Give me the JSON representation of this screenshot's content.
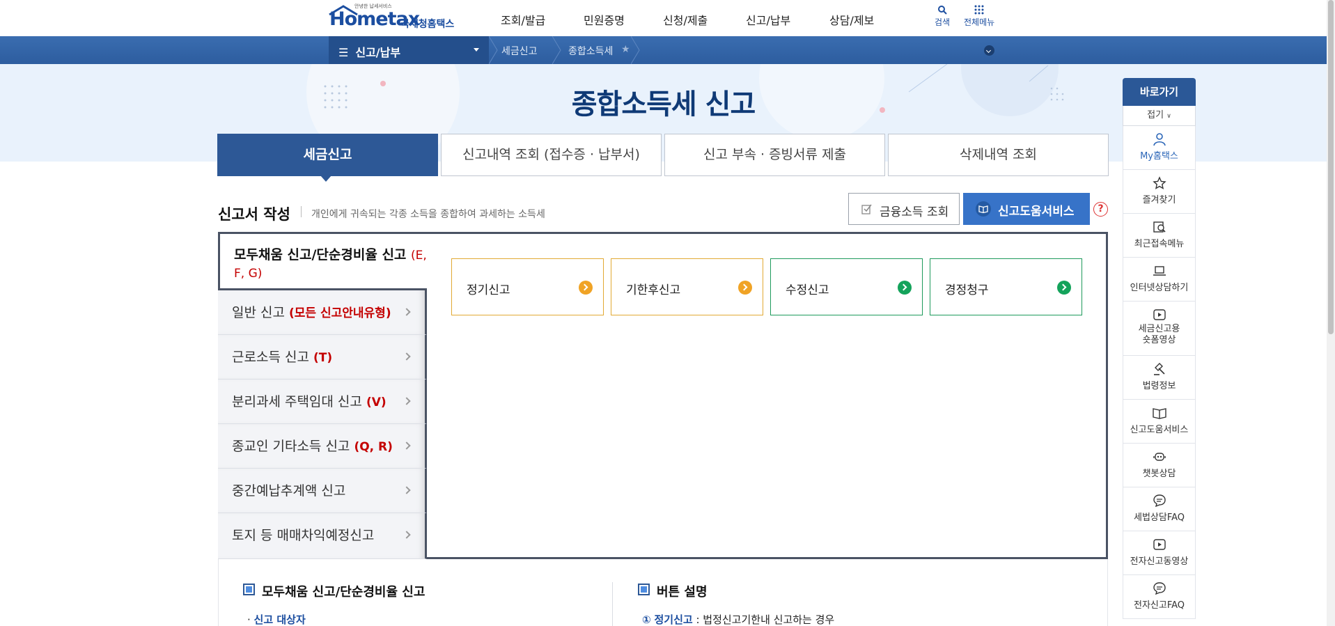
{
  "header": {
    "logo_tagline": "안녕한 납세서비스",
    "logo_main": "Hometax",
    "logo_sub": "국세청홈택스",
    "nav": [
      "조회/발급",
      "민원증명",
      "신청/제출",
      "신고/납부",
      "상담/제보"
    ],
    "search_label": "검색",
    "allmenu_label": "전체메뉴"
  },
  "breadcrumb": {
    "menu": "신고/납부",
    "items": [
      "세금신고",
      "종합소득세"
    ]
  },
  "page_title": "종합소득세 신고",
  "tabs": [
    "세금신고",
    "신고내역 조회 (접수증 · 납부서)",
    "신고 부속 · 증빙서류 제출",
    "삭제내역 조회"
  ],
  "section": {
    "title": "신고서 작성",
    "desc": "개인에게 귀속되는 각종 소득을 종합하여 과세하는 소득세",
    "fin_button": "금융소득 조회",
    "help_button": "신고도움서비스",
    "help_icon": "?"
  },
  "side_menu": {
    "first_label": "모두채움 신고/단순경비율 신고",
    "first_code": "(E, F, G)",
    "items": [
      {
        "label": "일반 신고",
        "code": "(모든 신고안내유형)"
      },
      {
        "label": "근로소득 신고",
        "code": "(T)"
      },
      {
        "label": "분리과세 주택임대 신고",
        "code": "(V)"
      },
      {
        "label": "종교인 기타소득 신고",
        "code": "(Q, R)"
      },
      {
        "label": "중간예납추계액 신고",
        "code": ""
      },
      {
        "label": "토지 등 매매차익예정신고",
        "code": ""
      }
    ]
  },
  "cards": [
    "정기신고",
    "기한후신고",
    "수정신고",
    "경정청구"
  ],
  "lower": {
    "left_title": "모두채움 신고/단순경비율 신고",
    "left_sub": "신고 대상자",
    "right_title": "버튼 설명",
    "right_num": "①",
    "right_term": "정기신고",
    "right_text": " : 법정신고기한내 신고하는 경우"
  },
  "quick": {
    "title": "바로가기",
    "fold": "접기",
    "items": [
      "My홈택스",
      "즐겨찾기",
      "최근접속메뉴",
      "인터넷상담하기",
      "세금신고용 숏폼영상",
      "법령정보",
      "신고도움서비스",
      "챗봇상담",
      "세법상담FAQ",
      "전자신고동영상",
      "전자신고FAQ"
    ]
  },
  "colors": {
    "brand": "#2d5896",
    "accent_orange": "#f0a325",
    "accent_green": "#14a35b",
    "red": "#c40000"
  }
}
